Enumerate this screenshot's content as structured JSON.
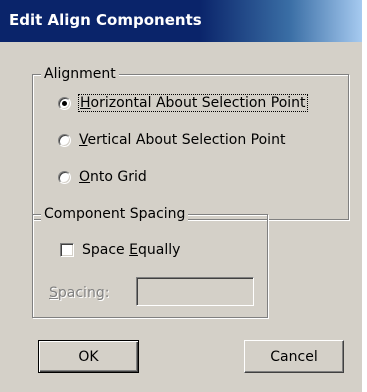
{
  "window": {
    "title": "Edit Align Components"
  },
  "alignment": {
    "legend": "Alignment",
    "options": [
      {
        "label": "Horizontal About Selection Point",
        "mnemonic": "H",
        "rest": "orizontal About Selection Point",
        "selected": true
      },
      {
        "label": "Vertical About Selection Point",
        "mnemonic": "V",
        "rest": "ertical About Selection Point",
        "selected": false
      },
      {
        "label": "Onto Grid",
        "mnemonic": "O",
        "rest": "nto Grid",
        "selected": false
      }
    ]
  },
  "spacing": {
    "legend": "Component Spacing",
    "space_equally": {
      "pre": "Space ",
      "mnemonic": "E",
      "rest": "qually",
      "checked": false
    },
    "spacing_label": {
      "mnemonic": "S",
      "rest": "pacing:"
    },
    "spacing_value": "",
    "enabled": false
  },
  "buttons": {
    "ok": "OK",
    "cancel": "Cancel"
  }
}
